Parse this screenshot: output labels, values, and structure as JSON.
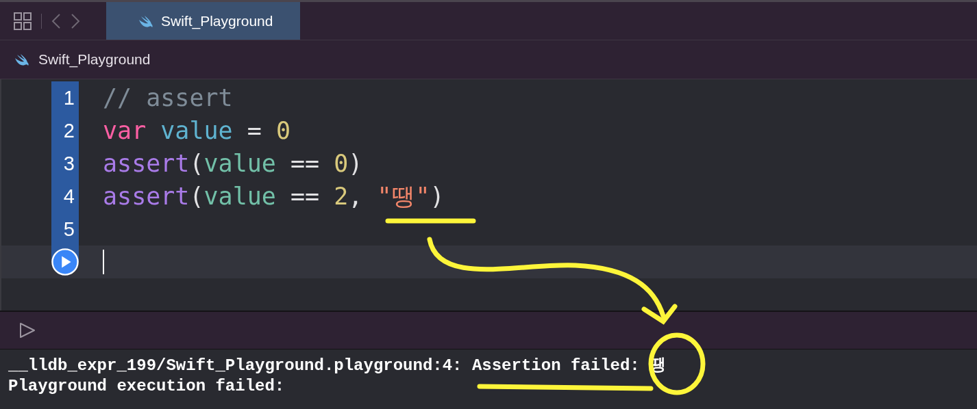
{
  "toolbar": {
    "tabs": [
      {
        "label": "Swift_Playground",
        "selected": true
      }
    ]
  },
  "breadcrumb": {
    "label": "Swift_Playground"
  },
  "editor": {
    "lines": [
      {
        "number": "1",
        "executed": true,
        "tokens": [
          {
            "kind": "comment",
            "text": "// assert"
          }
        ]
      },
      {
        "number": "2",
        "executed": true,
        "tokens": [
          {
            "kind": "keyword",
            "text": "var"
          },
          {
            "kind": "declaration",
            "text": " value"
          },
          {
            "kind": "plain",
            "text": " = "
          },
          {
            "kind": "number",
            "text": "0"
          }
        ]
      },
      {
        "number": "3",
        "executed": true,
        "tokens": [
          {
            "kind": "function",
            "text": "assert"
          },
          {
            "kind": "plain",
            "text": "("
          },
          {
            "kind": "reference",
            "text": "value"
          },
          {
            "kind": "plain",
            "text": " == "
          },
          {
            "kind": "number",
            "text": "0"
          },
          {
            "kind": "plain",
            "text": ")"
          }
        ]
      },
      {
        "number": "4",
        "executed": true,
        "tokens": [
          {
            "kind": "function",
            "text": "assert"
          },
          {
            "kind": "plain",
            "text": "("
          },
          {
            "kind": "reference",
            "text": "value"
          },
          {
            "kind": "plain",
            "text": " == "
          },
          {
            "kind": "number",
            "text": "2"
          },
          {
            "kind": "plain",
            "text": ", "
          },
          {
            "kind": "string",
            "text": "\"땡\""
          },
          {
            "kind": "plain",
            "text": ")"
          }
        ]
      },
      {
        "number": "5",
        "executed": true
      }
    ],
    "run_line": {
      "current": true
    }
  },
  "console": {
    "lines": [
      "__lldb_expr_199/Swift_Playground.playground:4: Assertion failed: 땡",
      "Playground execution failed:"
    ]
  }
}
